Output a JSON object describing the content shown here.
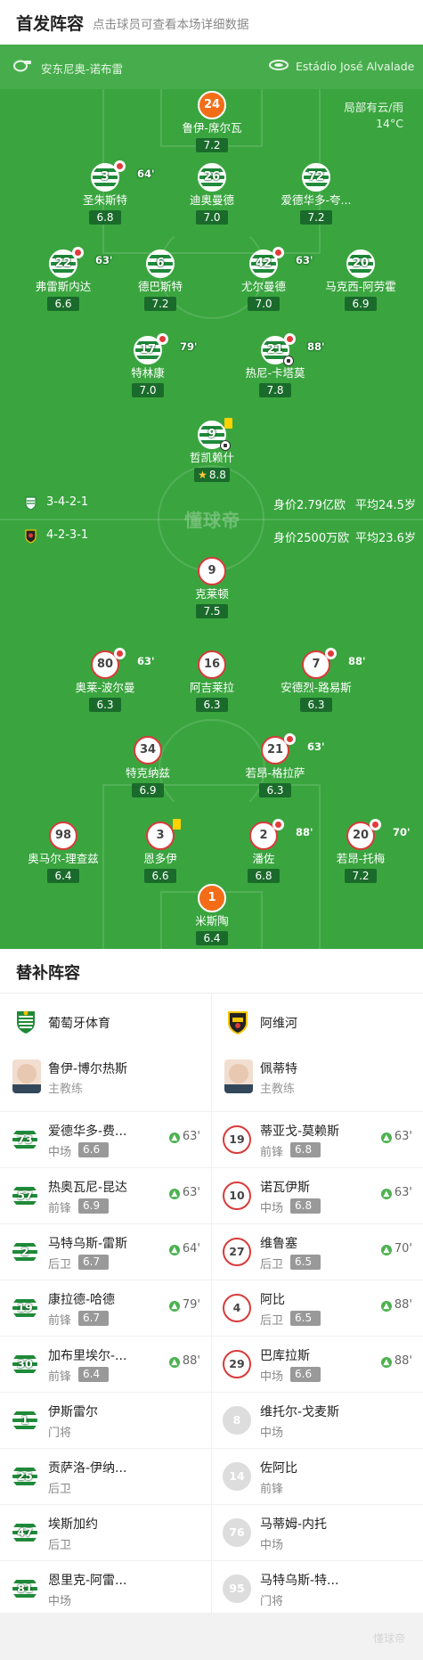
{
  "header": {
    "title": "首发阵容",
    "subtitle": "点击球员可查看本场详细数据"
  },
  "pitch": {
    "home_team": "安东尼奥-诺布雷",
    "stadium": "Estádio José Alvalade",
    "weather": "局部有云/雨",
    "temperature": "14°C",
    "watermark": "懂球帝",
    "home_formation": "3-4-2-1",
    "home_value": "身价2.79亿欧",
    "home_age": "平均24.5岁",
    "away_formation": "4-2-3-1",
    "away_value": "身价2500万欧",
    "away_age": "平均23.6岁"
  },
  "home_players": [
    {
      "num": "24",
      "name": "鲁伊-席尔瓦",
      "rating": "7.2"
    },
    {
      "num": "3",
      "name": "圣朱斯特",
      "rating": "6.8",
      "sub": "64'"
    },
    {
      "num": "26",
      "name": "迪奥曼德",
      "rating": "7.0"
    },
    {
      "num": "72",
      "name": "爱德华多-夸...",
      "rating": "7.2"
    },
    {
      "num": "22",
      "name": "弗雷斯内达",
      "rating": "6.6",
      "sub": "63'"
    },
    {
      "num": "6",
      "name": "德巴斯特",
      "rating": "7.2"
    },
    {
      "num": "42",
      "name": "尤尔曼德",
      "rating": "7.0",
      "sub": "63'"
    },
    {
      "num": "20",
      "name": "马克西-阿劳霍",
      "rating": "6.9"
    },
    {
      "num": "17",
      "name": "特林康",
      "rating": "7.0",
      "sub": "79'"
    },
    {
      "num": "21",
      "name": "热尼-卡塔莫",
      "rating": "7.8",
      "sub": "88'"
    },
    {
      "num": "9",
      "name": "哲凯赖什",
      "rating": "8.8"
    }
  ],
  "away_players": [
    {
      "num": "9",
      "name": "克莱顿",
      "rating": "7.5"
    },
    {
      "num": "80",
      "name": "奥莱-波尔曼",
      "rating": "6.3",
      "sub": "63'"
    },
    {
      "num": "16",
      "name": "阿吉莱拉",
      "rating": "6.3"
    },
    {
      "num": "7",
      "name": "安德烈-路易斯",
      "rating": "6.3",
      "sub": "88'"
    },
    {
      "num": "34",
      "name": "特克纳兹",
      "rating": "6.9"
    },
    {
      "num": "21",
      "name": "若昂-格拉萨",
      "rating": "6.3",
      "sub": "63'"
    },
    {
      "num": "98",
      "name": "奥马尔-理查兹",
      "rating": "6.4"
    },
    {
      "num": "3",
      "name": "恩多伊",
      "rating": "6.6"
    },
    {
      "num": "2",
      "name": "潘佐",
      "rating": "6.8",
      "sub": "88'"
    },
    {
      "num": "20",
      "name": "若昂-托梅",
      "rating": "7.2",
      "sub": "70'"
    },
    {
      "num": "1",
      "name": "米斯陶",
      "rating": "6.4"
    }
  ],
  "subs": {
    "title": "替补阵容",
    "home": {
      "team": "葡萄牙体育",
      "coach": "鲁伊-博尔热斯",
      "coach_role": "主教练",
      "players": [
        {
          "num": "73",
          "name": "爱德华多-费...",
          "pos": "中场",
          "rating": "6.6",
          "in": "63'"
        },
        {
          "num": "57",
          "name": "热奥瓦尼-昆达",
          "pos": "前锋",
          "rating": "6.9",
          "in": "63'"
        },
        {
          "num": "2",
          "name": "马特乌斯-雷斯",
          "pos": "后卫",
          "rating": "6.7",
          "in": "64'"
        },
        {
          "num": "19",
          "name": "康拉德-哈德",
          "pos": "前锋",
          "rating": "6.7",
          "in": "79'"
        },
        {
          "num": "30",
          "name": "加布里埃尔-...",
          "pos": "前锋",
          "rating": "6.4",
          "in": "88'"
        },
        {
          "num": "1",
          "name": "伊斯雷尔",
          "pos": "门将"
        },
        {
          "num": "25",
          "name": "贡萨洛-伊纳...",
          "pos": "后卫"
        },
        {
          "num": "47",
          "name": "埃斯加约",
          "pos": "后卫"
        },
        {
          "num": "81",
          "name": "恩里克-阿雷...",
          "pos": "中场"
        }
      ]
    },
    "away": {
      "team": "阿维河",
      "coach": "佩蒂特",
      "coach_role": "主教练",
      "players": [
        {
          "num": "19",
          "name": "蒂亚戈-莫赖斯",
          "pos": "前锋",
          "rating": "6.8",
          "in": "63'"
        },
        {
          "num": "10",
          "name": "诺瓦伊斯",
          "pos": "中场",
          "rating": "6.8",
          "in": "63'"
        },
        {
          "num": "27",
          "name": "维鲁塞",
          "pos": "后卫",
          "rating": "6.5",
          "in": "70'"
        },
        {
          "num": "4",
          "name": "阿比",
          "pos": "后卫",
          "rating": "6.5",
          "in": "88'"
        },
        {
          "num": "29",
          "name": "巴库拉斯",
          "pos": "中场",
          "rating": "6.6",
          "in": "88'"
        },
        {
          "num": "8",
          "name": "维托尔-戈麦斯",
          "pos": "中场"
        },
        {
          "num": "14",
          "name": "佐阿比",
          "pos": "前锋"
        },
        {
          "num": "76",
          "name": "马蒂姆-内托",
          "pos": "中场"
        },
        {
          "num": "95",
          "name": "马特乌斯-特...",
          "pos": "门将"
        }
      ]
    }
  },
  "footer": {
    "watermark": "懂球帝"
  },
  "colors": {
    "pitch": "#3aa53f",
    "home_stripe": "#1f8a3a",
    "away_ring": "#d93a3a",
    "keeper": "#f36d18",
    "rating_bg": "#1a6b2b"
  }
}
